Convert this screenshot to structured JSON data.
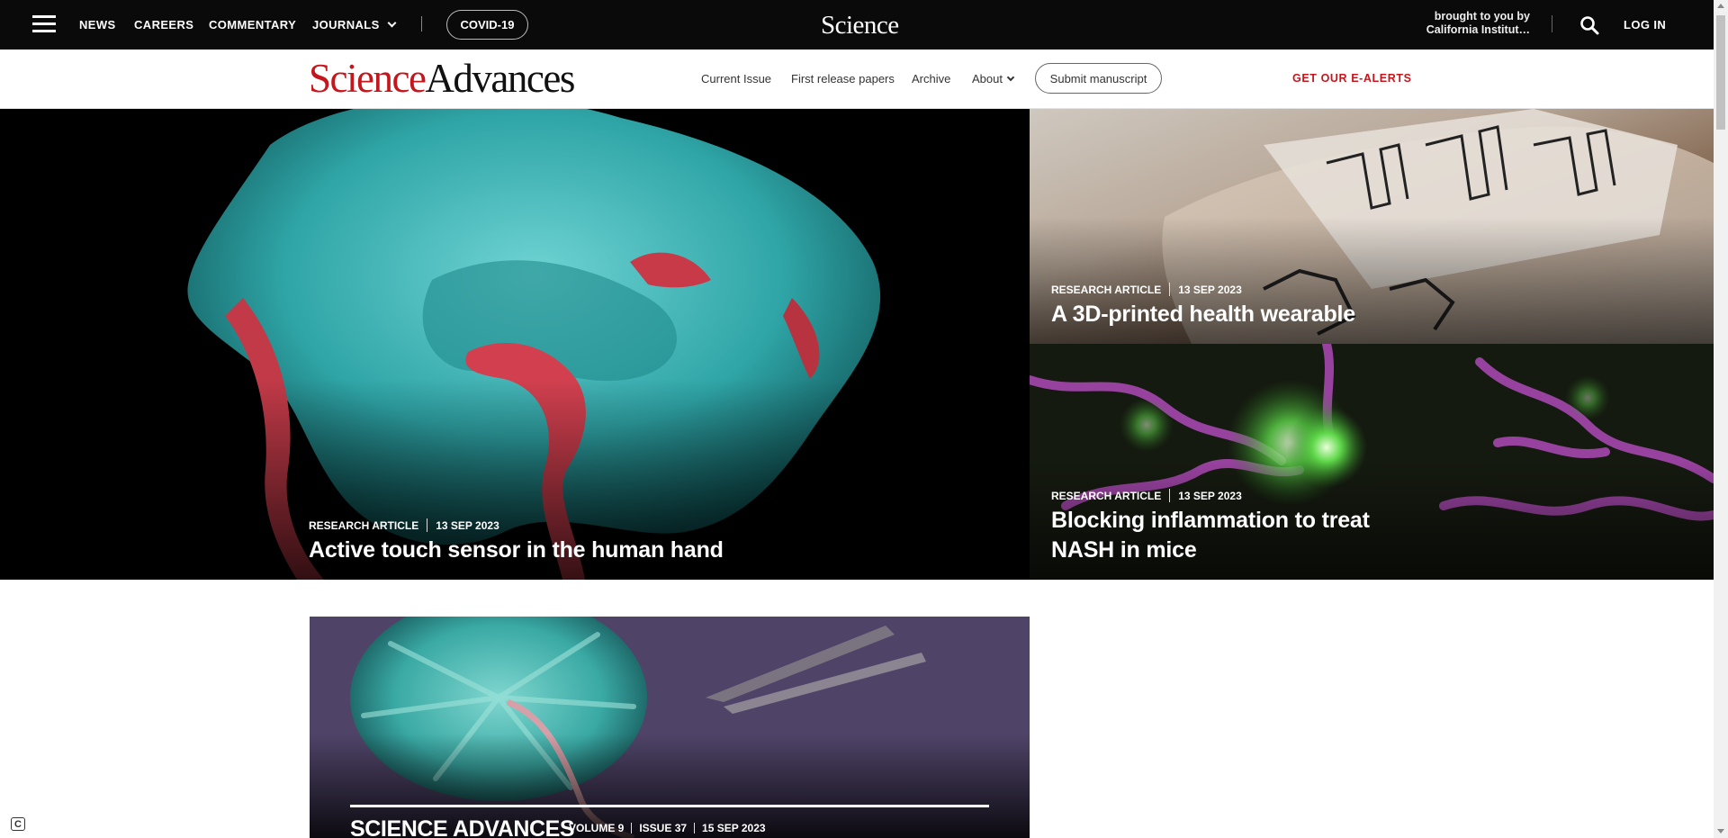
{
  "topbar": {
    "nav": [
      "NEWS",
      "CAREERS",
      "COMMENTARY",
      "JOURNALS"
    ],
    "covid": "COVID-19",
    "logo": "Science",
    "brought_line1": "brought to you by",
    "brought_line2": "California Institut…",
    "login": "LOG IN"
  },
  "journal": {
    "logo_science": "Science",
    "logo_advances": "Advances",
    "nav": [
      "Current Issue",
      "First release papers",
      "Archive",
      "About"
    ],
    "submit": "Submit manuscript",
    "ealerts": "GET OUR E-ALERTS"
  },
  "hero": {
    "main": {
      "type": "RESEARCH ARTICLE",
      "date": "13 SEP 2023",
      "title": "Active touch sensor in the human hand"
    },
    "top_right": {
      "type": "RESEARCH ARTICLE",
      "date": "13 SEP 2023",
      "title": "A 3D-printed health wearable"
    },
    "bottom_right": {
      "type": "RESEARCH ARTICLE",
      "date": "13 SEP 2023",
      "title_line1": "Blocking inflammation to treat",
      "title_line2": "NASH in mice"
    }
  },
  "issue": {
    "name": "SCIENCE ADVANCES",
    "volume": "VOLUME 9",
    "issue": "ISSUE 37",
    "date": "15 SEP 2023"
  },
  "cookie_label": "C",
  "colors": {
    "brand_red": "#c4161c",
    "topbar": "#0a0a0a"
  },
  "icons": [
    "hamburger-icon",
    "chevron-down-icon",
    "search-icon",
    "cookie-settings-icon"
  ]
}
